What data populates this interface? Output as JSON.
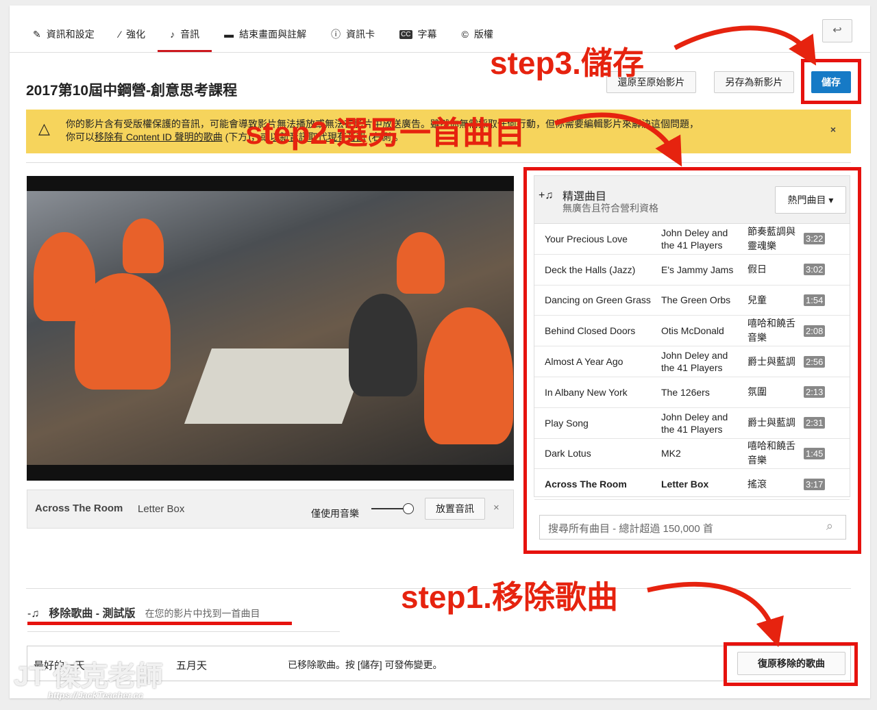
{
  "tabs": [
    {
      "label": "資訊和設定",
      "icon": "pencil-icon"
    },
    {
      "label": "強化",
      "icon": "magic-wand-icon"
    },
    {
      "label": "音訊",
      "icon": "music-note-icon",
      "active": true
    },
    {
      "label": "結束畫面與註解",
      "icon": "end-screen-icon"
    },
    {
      "label": "資訊卡",
      "icon": "info-icon"
    },
    {
      "label": "字幕",
      "icon": "cc-icon"
    },
    {
      "label": "版權",
      "icon": "copyright-icon"
    }
  ],
  "video_title": "2017第10屆中鋼營-創意思考課程",
  "buttons": {
    "revert": "還原至原始影片",
    "save_as_new": "另存為新影片",
    "save": "儲存"
  },
  "banner": {
    "line1": "你的影片含有受版權保護的音訊，可能會導致影片無法播放或無法在影片中放送廣告。雖然你無需採取任何行動，但你需要編輯影片來解決這個問題，",
    "line2_pre": "你可以",
    "link1": "移除有 Content ID 聲明的歌曲",
    "mid": " (下方)，或",
    "link2": "以新音訊取代現有音訊",
    "post": " (右側)。"
  },
  "now_playing": {
    "title": "Across The Room",
    "artist": "Letter Box",
    "music_only": "僅使用音樂",
    "music_only_on": true,
    "place_audio": "放置音訊"
  },
  "panel": {
    "title": "精選曲目",
    "subtitle": "無廣告且符合營利資格",
    "dropdown": "熱門曲目",
    "tracks": [
      {
        "title": "Your Precious Love",
        "artist": "John Deley and the 41 Players",
        "genre": "節奏藍調與靈魂樂",
        "duration": "3:22"
      },
      {
        "title": "Deck the Halls (Jazz)",
        "artist": "E's Jammy Jams",
        "genre": "假日",
        "duration": "3:02"
      },
      {
        "title": "Dancing on Green Grass",
        "artist": "The Green Orbs",
        "genre": "兒童",
        "duration": "1:54"
      },
      {
        "title": "Behind Closed Doors",
        "artist": "Otis McDonald",
        "genre": "嘻哈和饒舌音樂",
        "duration": "2:08"
      },
      {
        "title": "Almost A Year Ago",
        "artist": "John Deley and the 41 Players",
        "genre": "爵士與藍調",
        "duration": "2:56"
      },
      {
        "title": "In Albany New York",
        "artist": "The 126ers",
        "genre": "氛圍",
        "duration": "2:13"
      },
      {
        "title": "Play Song",
        "artist": "John Deley and the 41 Players",
        "genre": "爵士與藍調",
        "duration": "2:31"
      },
      {
        "title": "Dark Lotus",
        "artist": "MK2",
        "genre": "嘻哈和饒舌音樂",
        "duration": "1:45"
      },
      {
        "title": "Across The Room",
        "artist": "Letter Box",
        "genre": "搖滾",
        "duration": "3:17"
      }
    ],
    "search_placeholder": "搜尋所有曲目 - 總計超過 150,000 首"
  },
  "remove": {
    "tab": "移除歌曲 - 測試版",
    "hint": "在您的影片中找到一首曲目",
    "song": "最好的一天",
    "artist": "五月天",
    "status": "已移除歌曲。按 [儲存] 可發佈變更。",
    "restore": "復原移除的歌曲"
  },
  "annotations": {
    "step1": "step1.移除歌曲",
    "step2": "step2.選另一首曲目",
    "step3": "step3.儲存"
  },
  "watermark": {
    "name": "傑克老師",
    "url": "https://JackTeacher.cc"
  },
  "colors": {
    "annotation": "#e6230f",
    "save": "#167ac6",
    "banner": "#f6d45c"
  }
}
